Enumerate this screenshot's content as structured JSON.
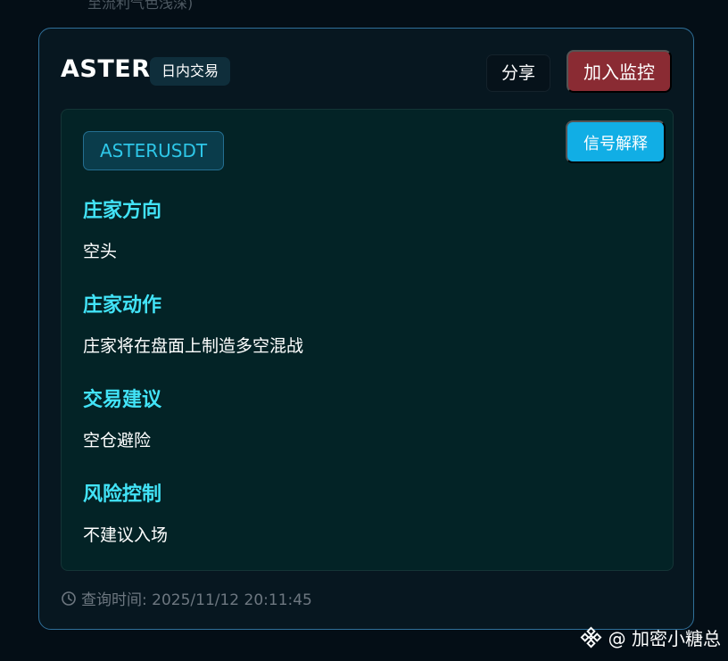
{
  "top_fragment": "至流利气色浅深)",
  "card": {
    "title": "ASTER",
    "badge": "日内交易",
    "share_label": "分享",
    "monitor_label": "加入监控",
    "pair": "ASTERUSDT",
    "signal_label": "信号解释",
    "sections": [
      {
        "title": "庄家方向",
        "value": "空头"
      },
      {
        "title": "庄家动作",
        "value": "庄家将在盘面上制造多空混战"
      },
      {
        "title": "交易建议",
        "value": "空仓避险"
      },
      {
        "title": "风险控制",
        "value": "不建议入场"
      }
    ],
    "timestamp": "查询时间: 2025/11/12 20:11:45"
  },
  "watermark": {
    "text": "@ 加密小糖总",
    "icon": "binance-diamond-icon"
  },
  "colors": {
    "accent": "#42e3f7",
    "button_red": "#8a2b33",
    "button_blue": "#11aee5",
    "card_border": "#2f6f99"
  }
}
